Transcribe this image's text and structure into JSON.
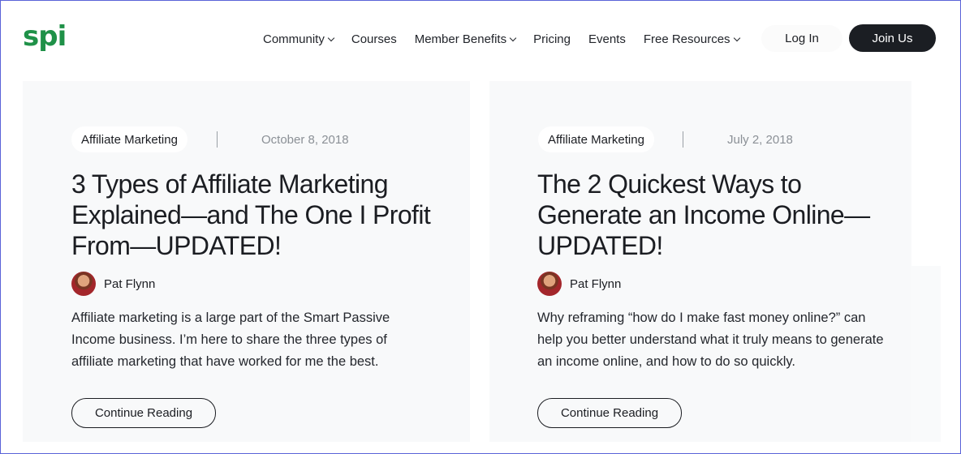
{
  "header": {
    "logo_text": "spi",
    "nav": [
      {
        "label": "Community",
        "has_dropdown": true
      },
      {
        "label": "Courses",
        "has_dropdown": false
      },
      {
        "label": "Member Benefits",
        "has_dropdown": true
      },
      {
        "label": "Pricing",
        "has_dropdown": false
      },
      {
        "label": "Events",
        "has_dropdown": false
      },
      {
        "label": "Free Resources",
        "has_dropdown": true
      }
    ],
    "login_label": "Log In",
    "join_label": "Join Us"
  },
  "posts": [
    {
      "category": "Affiliate Marketing",
      "date": "October 8, 2018",
      "title": "3 Types of Affiliate Marketing Explained—and The One I Profit From—UPDATED!",
      "author": "Pat Flynn",
      "excerpt": "Affiliate marketing is a large part of the Smart Passive Income business. I’m here to share the three types of affiliate marketing that have worked for me the best.",
      "cta": "Continue Reading"
    },
    {
      "category": "Affiliate Marketing",
      "date": "July 2, 2018",
      "title": "The 2 Quickest Ways to Generate an Income Online—UPDATED!",
      "author": "Pat Flynn",
      "excerpt": "Why reframing “how do I make fast money online?” can help you better understand what it truly means to generate an income online, and how to do so quickly.",
      "cta": "Continue Reading"
    }
  ],
  "colors": {
    "brand_green": "#1f9148",
    "dark_button": "#1b1e23",
    "card_bg": "#f8f9fa",
    "date_gray": "#8b9096"
  }
}
